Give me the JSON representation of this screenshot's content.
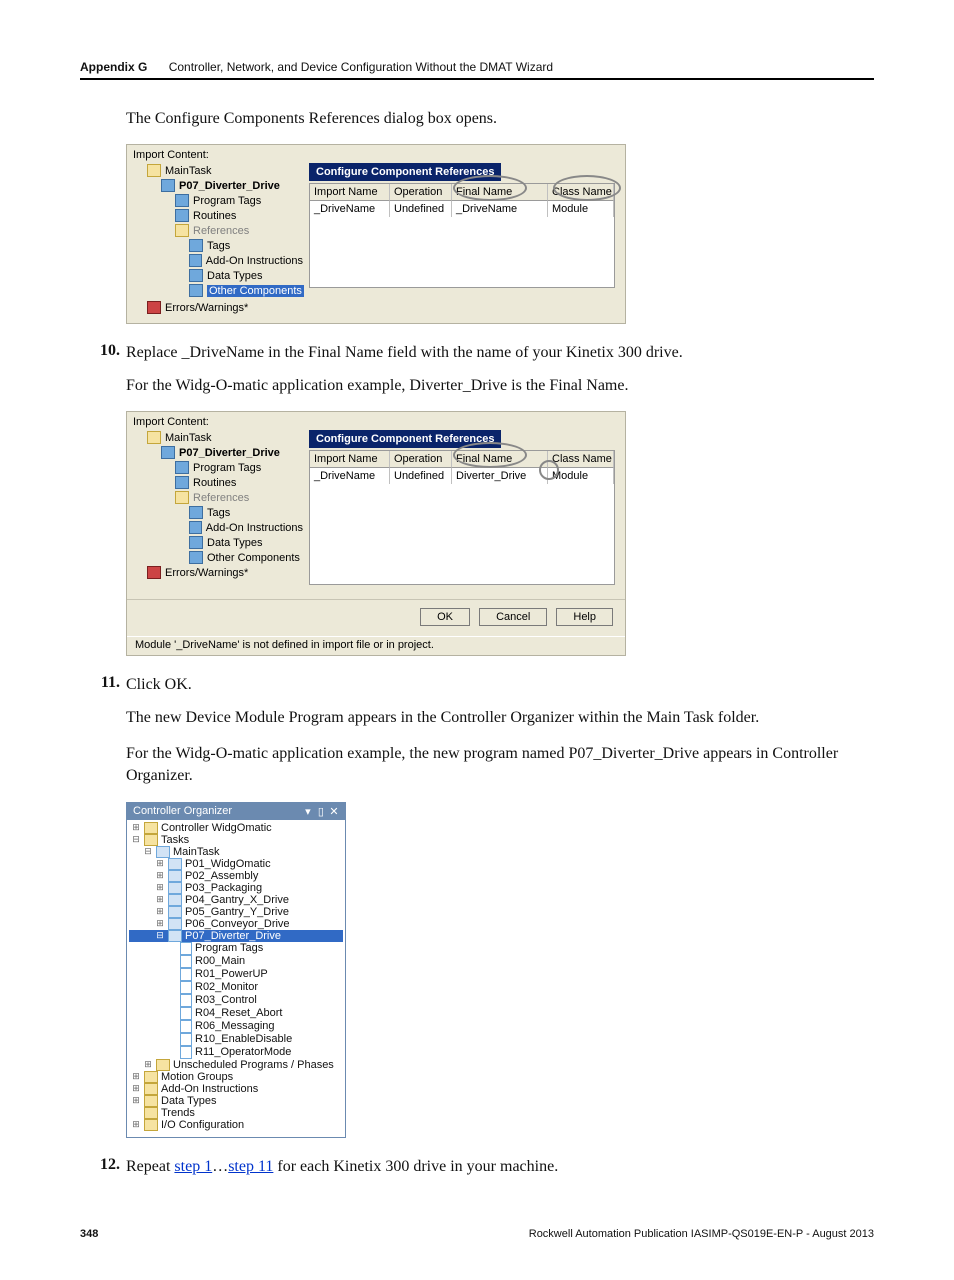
{
  "header": {
    "appendix": "Appendix G",
    "title": "Controller, Network, and Device Configuration Without the DMAT Wizard"
  },
  "intro_line": "The Configure Components References dialog box opens.",
  "fig1": {
    "label_import_content": "Import Content:",
    "tree": {
      "main_task": "MainTask",
      "prog": "P07_Diverter_Drive",
      "prog_tags": "Program Tags",
      "routines": "Routines",
      "references": "References",
      "tags": "Tags",
      "aoi": "Add-On Instructions",
      "data_types": "Data Types",
      "other": "Other Components",
      "errors": "Errors/Warnings*"
    },
    "grid": {
      "title": "Configure Component References",
      "cols": {
        "c1": "Import Name",
        "c2": "Operation",
        "c3": "Final Name",
        "c4": "Class Name"
      },
      "row": {
        "c1": "_DriveName",
        "c2": "Undefined",
        "c3": "_DriveName",
        "c4": "Module"
      }
    }
  },
  "step10_num": "10.",
  "step10_text": "Replace _DriveName in the Final Name field with the name of your Kinetix 300 drive.",
  "step10_sub": "For the Widg-O-matic application example, Diverter_Drive is the Final Name.",
  "fig2": {
    "label_import_content": "Import Content:",
    "tree": {
      "main_task": "MainTask",
      "prog": "P07_Diverter_Drive",
      "prog_tags": "Program Tags",
      "routines": "Routines",
      "references": "References",
      "tags": "Tags",
      "aoi": "Add-On Instructions",
      "data_types": "Data Types",
      "other": "Other Components",
      "errors": "Errors/Warnings*"
    },
    "grid": {
      "title": "Configure Component References",
      "cols": {
        "c1": "Import Name",
        "c2": "Operation",
        "c3": "Final Name",
        "c4": "Class Name"
      },
      "row": {
        "c1": "_DriveName",
        "c2": "Undefined",
        "c3": "Diverter_Drive",
        "c4": "Module"
      }
    },
    "buttons": {
      "ok": "OK",
      "cancel": "Cancel",
      "help": "Help"
    },
    "status": "Module '_DriveName' is not defined in import file or in project."
  },
  "step11_num": "11.",
  "step11_text": "Click OK.",
  "step11_p1": "The new Device Module Program appears in the Controller Organizer within the Main Task folder.",
  "step11_p2": "For the Widg-O-matic application example, the new program named P07_Diverter_Drive appears in Controller Organizer.",
  "co": {
    "title": "Controller Organizer",
    "items": {
      "ctrl": "Controller WidgOmatic",
      "tasks": "Tasks",
      "main": "MainTask",
      "p01": "P01_WidgOmatic",
      "p02": "P02_Assembly",
      "p03": "P03_Packaging",
      "p04": "P04_Gantry_X_Drive",
      "p05": "P05_Gantry_Y_Drive",
      "p06": "P06_Conveyor_Drive",
      "p07": "P07_Diverter_Drive",
      "prog_tags": "Program Tags",
      "r00": "R00_Main",
      "r01": "R01_PowerUP",
      "r02": "R02_Monitor",
      "r03": "R03_Control",
      "r04": "R04_Reset_Abort",
      "r06": "R06_Messaging",
      "r10": "R10_EnableDisable",
      "r11": "R11_OperatorMode",
      "unsched": "Unscheduled Programs / Phases",
      "motion": "Motion Groups",
      "aoi": "Add-On Instructions",
      "dtypes": "Data Types",
      "trends": "Trends",
      "iocfg": "I/O Configuration"
    }
  },
  "step12_num": "12.",
  "step12_pre": "Repeat ",
  "step12_link1": "step 1",
  "step12_mid": "…",
  "step12_link2": "step 11",
  "step12_post": " for each Kinetix 300 drive in your machine.",
  "footer": {
    "page": "348",
    "pub": "Rockwell Automation Publication IASIMP-QS019E-EN-P - August 2013"
  }
}
